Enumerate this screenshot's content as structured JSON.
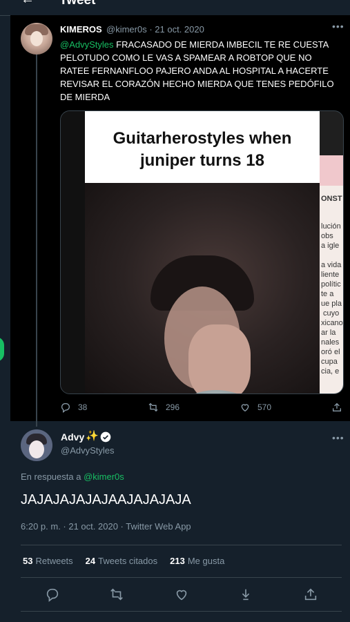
{
  "header": {
    "back_icon": "arrow-left-icon",
    "title": "Tweet"
  },
  "parent_tweet": {
    "author_name": "KIMEROS",
    "handle": "@kimer0s",
    "separator": "·",
    "date": "21 oct. 2020",
    "mention": "@AdvyStyles",
    "text": "FRACASADO DE MIERDA IMBECIL TE RE CUESTA PELOTUDO COMO LE VAS A SPAMEAR A ROBTOP QUE NO RATEE FERNANFLOO PAJERO ANDA AL HOSPITAL A HACERTE REVISAR EL CORAZÓN HECHO MIERDA QUE TENES PEDÓFILO DE MIERDA",
    "media_caption_line1": "Guitarherostyles when",
    "media_caption_line2": "juniper turns 18",
    "media_doc_title": "ONST",
    "media_doc_lines": "lución\nobs\na igle\n\na vida\nliente\npolític\nte a\nue pla\n cuyo\nxicano\nar la\nnales\noró el\ncupa\ncia, e",
    "reply_count": "38",
    "retweet_count": "296",
    "like_count": "570"
  },
  "main_tweet": {
    "author_name": "Advy",
    "sparkle": "✨",
    "handle": "@AdvyStyles",
    "replying_prefix": "En respuesta a",
    "replying_to": "@kimer0s",
    "text": "JAJAJAJAJAJAAJAJAJAJA",
    "timestamp": "6:20 p. m. · 21 oct. 2020 · Twitter Web App",
    "stats": {
      "retweets_value": "53",
      "retweets_label": "Retweets",
      "quotes_value": "24",
      "quotes_label": "Tweets citados",
      "likes_value": "213",
      "likes_label": "Me gusta"
    }
  },
  "colors": {
    "background": "#15202b",
    "parent_background": "#000000",
    "accent": "#17bf63",
    "muted": "#8899a6",
    "divider": "#38444d"
  }
}
